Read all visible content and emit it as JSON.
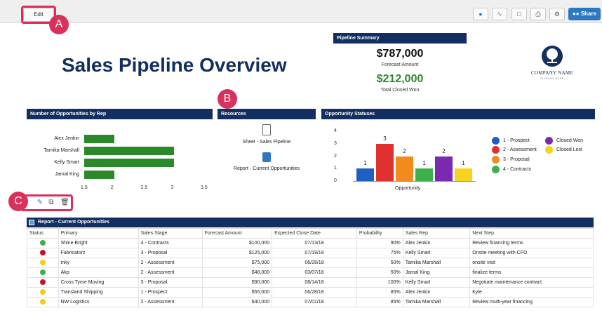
{
  "toolbar": {
    "edit_label": "Edit",
    "share_label": "Share",
    "icons": [
      "globe-icon",
      "activity-icon",
      "present-icon",
      "print-icon",
      "settings-icon"
    ]
  },
  "callouts": {
    "a": "A",
    "b": "B",
    "c": "C"
  },
  "title": "Sales Pipeline Overview",
  "pipeline_summary": {
    "header": "Pipeline Summary",
    "forecast_value": "$787,000",
    "forecast_label": "Forecast Amount",
    "closed_value": "$212,000",
    "closed_label": "Total Closed Won",
    "closed_color": "#2a8a2a"
  },
  "logo": {
    "name": "COMPANY NAME",
    "tagline": "SLOGAN HERE"
  },
  "rep_chart": {
    "header": "Number of Opportunities by Rep",
    "chart_data": {
      "type": "bar",
      "orientation": "horizontal",
      "categories": [
        "Alex Jenkin",
        "Tamika Marshall",
        "Kelly Smart",
        "Jamal King"
      ],
      "values": [
        2,
        3,
        3,
        2
      ],
      "xlim": [
        1.5,
        3.5
      ],
      "ticks": [
        "1.5",
        "2",
        "2.5",
        "3",
        "3.5"
      ],
      "bar_color": "#2a8a2a"
    }
  },
  "resources": {
    "header": "Resources",
    "items": [
      {
        "label": "Sheet - Sales Pipeline",
        "icon": "document-icon"
      },
      {
        "label": "Report - Current Opportunities",
        "icon": "report-icon"
      }
    ]
  },
  "status_chart": {
    "header": "Opportunity Statuses",
    "chart_data": {
      "type": "bar",
      "xlabel": "Opportunity",
      "ylim": [
        0,
        4
      ],
      "yticks": [
        "4",
        "3",
        "2",
        "1",
        "0"
      ],
      "series": [
        {
          "name": "1 - Prospect",
          "value": 1,
          "color": "#1f5fbf"
        },
        {
          "name": "2 - Assessment",
          "value": 3,
          "color": "#e03030"
        },
        {
          "name": "3 - Proposal",
          "value": 2,
          "color": "#f28a1e"
        },
        {
          "name": "4 - Contracts",
          "value": 1,
          "color": "#3cb04a"
        },
        {
          "name": "Closed Won",
          "value": 2,
          "color": "#7a2ab0"
        },
        {
          "name": "Closed Lost",
          "value": 1,
          "color": "#f7d21e"
        }
      ]
    }
  },
  "report": {
    "title": "Report - Current Opportunities",
    "columns": [
      "Status",
      "Primary",
      "Sales Stage",
      "Forecast Amount",
      "Expected Close Date",
      "Probability",
      "Sales Rep",
      "Next Step"
    ],
    "rows": [
      {
        "status_color": "#3cb04a",
        "primary": "Shine Bright",
        "stage": "4 - Contracts",
        "amount": "$100,000",
        "close": "07/13/18",
        "prob": "90%",
        "rep": "Alex Jenkin",
        "next": "Review financing terms"
      },
      {
        "status_color": "#c8102e",
        "primary": "Fabricatorz",
        "stage": "3 - Proposal",
        "amount": "$125,000",
        "close": "07/19/18",
        "prob": "75%",
        "rep": "Kelly Smart",
        "next": "Onsite meeting with CFO"
      },
      {
        "status_color": "#f7c81e",
        "primary": "inky",
        "stage": "2 - Assessment",
        "amount": "$75,000",
        "close": "06/28/18",
        "prob": "50%",
        "rep": "Tamika Marshall",
        "next": "onsite visit"
      },
      {
        "status_color": "#3cb04a",
        "primary": "Akp",
        "stage": "2 - Assessment",
        "amount": "$48,000",
        "close": "03/07/18",
        "prob": "50%",
        "rep": "Jamal King",
        "next": "finalize terms"
      },
      {
        "status_color": "#c8102e",
        "primary": "Cross Tyme Moving",
        "stage": "3 - Proposal",
        "amount": "$90,000",
        "close": "08/14/18",
        "prob": "100%",
        "rep": "Kelly Smart",
        "next": "Negotiate maintenance contract"
      },
      {
        "status_color": "#f7c81e",
        "primary": "Transland Shipping",
        "stage": "1 - Prospect",
        "amount": "$55,000",
        "close": "06/28/18",
        "prob": "85%",
        "rep": "Alex Jenkin",
        "next": "Kyle"
      },
      {
        "status_color": "#f7c81e",
        "primary": "NW Logistics",
        "stage": "2 - Assessment",
        "amount": "$40,000",
        "close": "07/01/18",
        "prob": "85%",
        "rep": "Tamika Marshall",
        "next": "Review multi-year financing"
      }
    ]
  }
}
